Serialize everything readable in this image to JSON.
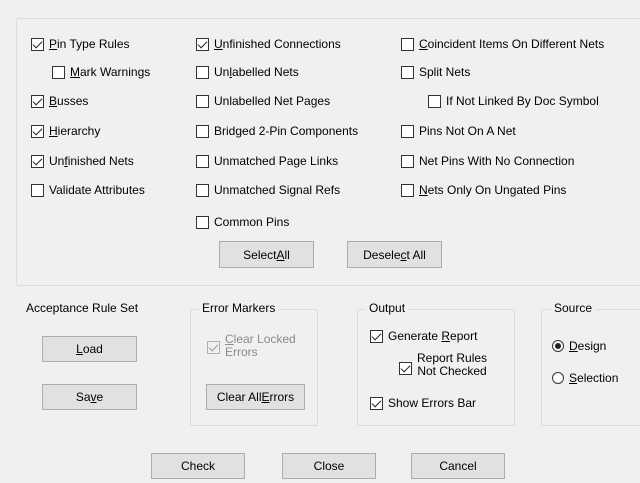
{
  "checks": {
    "pin_type_rules": {
      "pre": "",
      "ul": "P",
      "post": "in Type Rules",
      "checked": true
    },
    "mark_warnings": {
      "pre": "",
      "ul": "M",
      "post": "ark Warnings",
      "checked": false
    },
    "busses": {
      "pre": "",
      "ul": "B",
      "post": "usses",
      "checked": true
    },
    "hierarchy": {
      "pre": "",
      "ul": "H",
      "post": "ierarchy",
      "checked": true
    },
    "unfinished_nets": {
      "pre": "Un",
      "ul": "f",
      "post": "inished Nets",
      "checked": true
    },
    "validate_attributes": {
      "pre": "Validate Attributes",
      "ul": "",
      "post": "",
      "checked": false
    },
    "unfinished_connections": {
      "pre": "",
      "ul": "U",
      "post": "nfinished Connections",
      "checked": true
    },
    "unlabelled_nets": {
      "pre": "Un",
      "ul": "l",
      "post": "abelled Nets",
      "checked": false
    },
    "unlabelled_net_pages": {
      "pre": "Unlabelled Net Pages",
      "ul": "",
      "post": "",
      "checked": false
    },
    "bridged_2pin": {
      "pre": "Bridged 2-Pin Components",
      "ul": "",
      "post": "",
      "checked": false
    },
    "unmatched_page_links": {
      "pre": "Unmatched Page Links",
      "ul": "",
      "post": "",
      "checked": false
    },
    "unmatched_signal_refs": {
      "pre": "Unmatched Signal Refs",
      "ul": "",
      "post": "",
      "checked": false
    },
    "common_pins": {
      "pre": "Common Pins",
      "ul": "",
      "post": "",
      "checked": false
    },
    "coincident_items": {
      "pre": "",
      "ul": "C",
      "post": "oincident Items On Different Nets",
      "checked": false
    },
    "split_nets": {
      "pre": "Split Nets",
      "ul": "",
      "post": "",
      "checked": false
    },
    "if_not_linked": {
      "pre": "If Not Linked By Doc Symbol",
      "ul": "",
      "post": "",
      "checked": false
    },
    "pins_not_on_net": {
      "pre": "Pins Not On A Net",
      "ul": "",
      "post": "",
      "checked": false
    },
    "net_pins_no_connection": {
      "pre": "Net Pins With No Connection",
      "ul": "",
      "post": "",
      "checked": false
    },
    "nets_only_ungated": {
      "pre": "",
      "ul": "N",
      "post": "ets Only On Ungated Pins",
      "checked": false
    }
  },
  "buttons": {
    "select_all": {
      "pre": "Select ",
      "ul": "A",
      "post": "ll"
    },
    "deselect_all": {
      "pre": "Desele",
      "ul": "c",
      "post": "t All"
    },
    "load": {
      "pre": "",
      "ul": "L",
      "post": "oad"
    },
    "save": {
      "pre": "Sa",
      "ul": "v",
      "post": "e"
    },
    "clear_all_errors": {
      "pre": "Clear All ",
      "ul": "E",
      "post": "rrors"
    },
    "check": {
      "pre": "Check",
      "ul": "",
      "post": ""
    },
    "close": {
      "pre": "Close",
      "ul": "",
      "post": ""
    },
    "cancel": {
      "pre": "Cancel",
      "ul": "",
      "post": ""
    }
  },
  "groups": {
    "acceptance": "Acceptance Rule Set",
    "error_markers": "Error Markers",
    "output": "Output",
    "source": "Source"
  },
  "error_markers": {
    "clear_locked": {
      "ul": "C",
      "post1": "lear Locked",
      "line2": "Errors",
      "checked": true
    }
  },
  "output": {
    "generate_report": {
      "pre": "Generate ",
      "ul": "R",
      "post": "eport",
      "checked": true
    },
    "report_rules": {
      "line1": "Report Rules",
      "line2": "Not Checked",
      "checked": true
    },
    "show_errors_bar": {
      "pre": "Show Errors Bar",
      "checked": true
    }
  },
  "source": {
    "design": {
      "pre": "",
      "ul": "D",
      "post": "esign",
      "selected": true
    },
    "selection": {
      "pre": "",
      "ul": "S",
      "post": "election",
      "selected": false
    }
  }
}
